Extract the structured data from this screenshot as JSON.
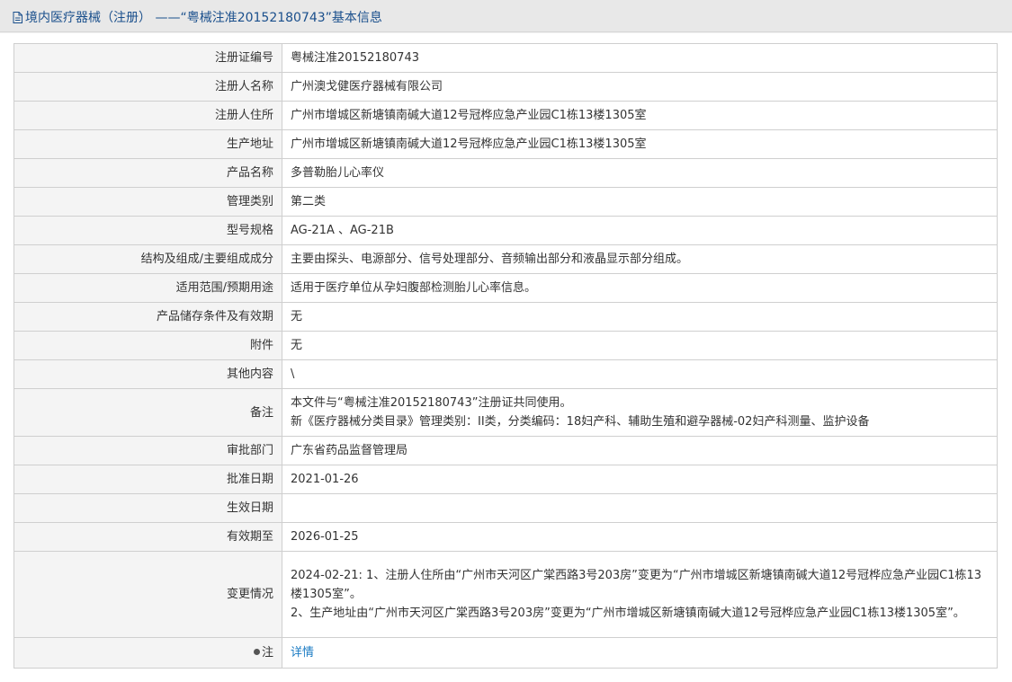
{
  "header": {
    "title": "境内医疗器械（注册） ——“粤械注准20152180743”基本信息",
    "icon": "document-icon"
  },
  "rows": [
    {
      "label": "注册证编号",
      "value": "粤械注准20152180743"
    },
    {
      "label": "注册人名称",
      "value": "广州澳戈健医疗器械有限公司"
    },
    {
      "label": "注册人住所",
      "value": "广州市增城区新塘镇南碱大道12号冠桦应急产业园C1栋13楼1305室"
    },
    {
      "label": "生产地址",
      "value": "广州市增城区新塘镇南碱大道12号冠桦应急产业园C1栋13楼1305室"
    },
    {
      "label": "产品名称",
      "value": "多普勒胎儿心率仪"
    },
    {
      "label": "管理类别",
      "value": "第二类"
    },
    {
      "label": "型号规格",
      "value": "AG-21A 、AG-21B"
    },
    {
      "label": "结构及组成/主要组成成分",
      "value": "主要由探头、电源部分、信号处理部分、音频输出部分和液晶显示部分组成。"
    },
    {
      "label": "适用范围/预期用途",
      "value": "适用于医疗单位从孕妇腹部检测胎儿心率信息。"
    },
    {
      "label": "产品储存条件及有效期",
      "value": "无"
    },
    {
      "label": "附件",
      "value": "无"
    },
    {
      "label": "其他内容",
      "value": "\\"
    },
    {
      "label": "备注",
      "lines": [
        "本文件与“粤械注准20152180743”注册证共同使用。",
        "新《医疗器械分类目录》管理类别：II类，分类编码：18妇产科、辅助生殖和避孕器械-02妇产科测量、监护设备"
      ]
    },
    {
      "label": "审批部门",
      "value": "广东省药品监督管理局"
    },
    {
      "label": "批准日期",
      "value": "2021-01-26"
    },
    {
      "label": "生效日期",
      "value": ""
    },
    {
      "label": "有效期至",
      "value": "2026-01-25"
    },
    {
      "label": "变更情况",
      "lines": [
        "2024-02-21: 1、注册人住所由“广州市天河区广棠西路3号203房”变更为“广州市增城区新塘镇南碱大道12号冠桦应急产业园C1栋13楼1305室”。",
        "2、生产地址由“广州市天河区广棠西路3号203房”变更为“广州市增城区新塘镇南碱大道12号冠桦应急产业园C1栋13楼1305室”。"
      ]
    },
    {
      "label": "注",
      "value": "详情",
      "label_icon": "pin-icon"
    }
  ]
}
